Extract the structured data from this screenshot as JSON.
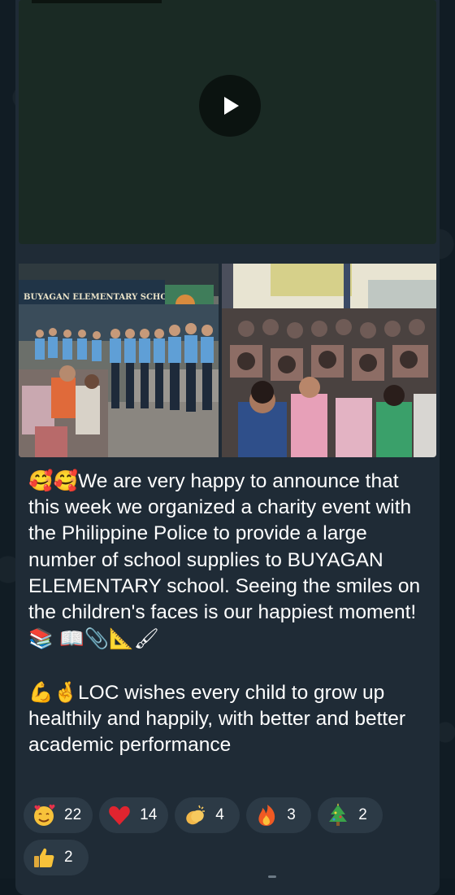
{
  "video": {
    "play_icon": "play-icon"
  },
  "photos": [
    {
      "name": "photo-police-at-school",
      "sign_text": "BUYAGAN ELEMENTARY SCHOOL"
    },
    {
      "name": "photo-children-seated"
    }
  ],
  "post": {
    "paragraph1_prefix": "🥰🥰",
    "paragraph1": "We are very happy to announce that this week we organized a charity event with the Philippine Police to provide a large number of school supplies to BUYAGAN ELEMENTARY school. Seeing the smiles on the children's faces is our happiest moment!",
    "paragraph1_suffix": "📚 📖📎📐🖌",
    "paragraph2_prefix": "💪🤞",
    "paragraph2": "LOC wishes every child to grow up healthily and happily, with better and better academic performance"
  },
  "reactions": [
    {
      "icon": "smiling-face-with-hearts-icon",
      "count": "22"
    },
    {
      "icon": "red-heart-icon",
      "count": "14"
    },
    {
      "icon": "clapping-hands-icon",
      "count": "4"
    },
    {
      "icon": "fire-icon",
      "count": "3"
    },
    {
      "icon": "christmas-tree-icon",
      "count": "2"
    },
    {
      "icon": "thumbs-up-icon",
      "count": "2"
    }
  ],
  "colors": {
    "bubble": "#1f2b36",
    "background": "#111c24",
    "reaction_pill": "#2c3a46",
    "text": "#ffffff"
  }
}
